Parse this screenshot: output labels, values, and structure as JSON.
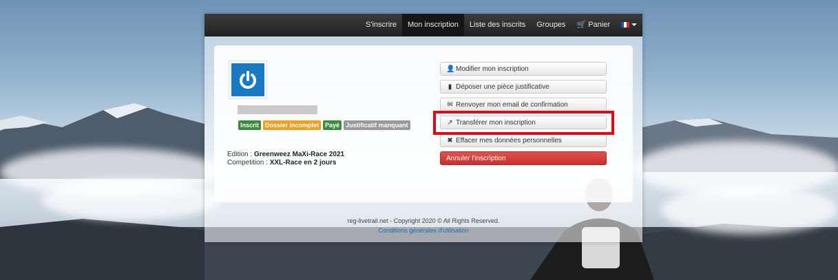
{
  "navbar": {
    "items": [
      {
        "label": "S'inscrire"
      },
      {
        "label": "Mon inscription",
        "active": true
      },
      {
        "label": "Liste des inscrits"
      },
      {
        "label": "Groupes"
      },
      {
        "label": "Panier",
        "icon": "cart-icon"
      }
    ],
    "language_flag": "flag-fr-icon"
  },
  "registration": {
    "badges": [
      {
        "label": "Inscrit",
        "color": "#3c8a3c"
      },
      {
        "label": "Dossier incomplet",
        "color": "#f0a020"
      },
      {
        "label": "Payé",
        "color": "#3c8a3c"
      },
      {
        "label": "Justificatif manquant",
        "color": "#999999"
      }
    ],
    "edition_label": "Edition : ",
    "edition_value": "Greenweez MaXi-Race 2021",
    "competition_label": "Competition : ",
    "competition_value": "XXL-Race en 2 jours"
  },
  "actions": {
    "modify": "Modifier mon inscription",
    "upload": "Déposer une pièce justificative",
    "resend_email": "Renvoyer mon email de confirmation",
    "transfer": "Transférer mon inscription",
    "erase_data": "Effacer mes données personnelles",
    "cancel": "Annuler l'inscription"
  },
  "footer": {
    "copyright": "reg-livetrail.net - Copyright 2020 © All Rights Reserved.",
    "terms_link": "Conditions générales d'utilisation"
  },
  "colors": {
    "highlight": "#e30613",
    "danger": "#d9534f",
    "logo_blue": "#1a79c3"
  }
}
